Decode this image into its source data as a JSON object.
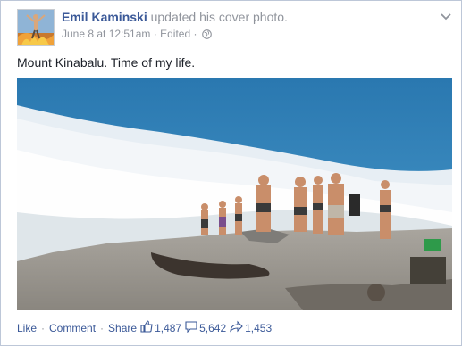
{
  "post": {
    "author": "Emil Kaminski",
    "action": "updated his cover photo.",
    "timestamp": "June 8 at 12:51am",
    "separator": "·",
    "edited": "Edited",
    "privacy_icon": "globe-icon",
    "caption": "Mount Kinabalu. Time of my life."
  },
  "footer": {
    "like": "Like",
    "comment": "Comment",
    "share": "Share",
    "dot": "·",
    "likes_count": "1,487",
    "comments_count": "5,642",
    "shares_count": "1,453"
  },
  "colors": {
    "link": "#3b5998",
    "meta": "#90949c",
    "sky": "#2f7fb6",
    "cloud": "#eef3f7",
    "rock": "#9e9a93"
  }
}
